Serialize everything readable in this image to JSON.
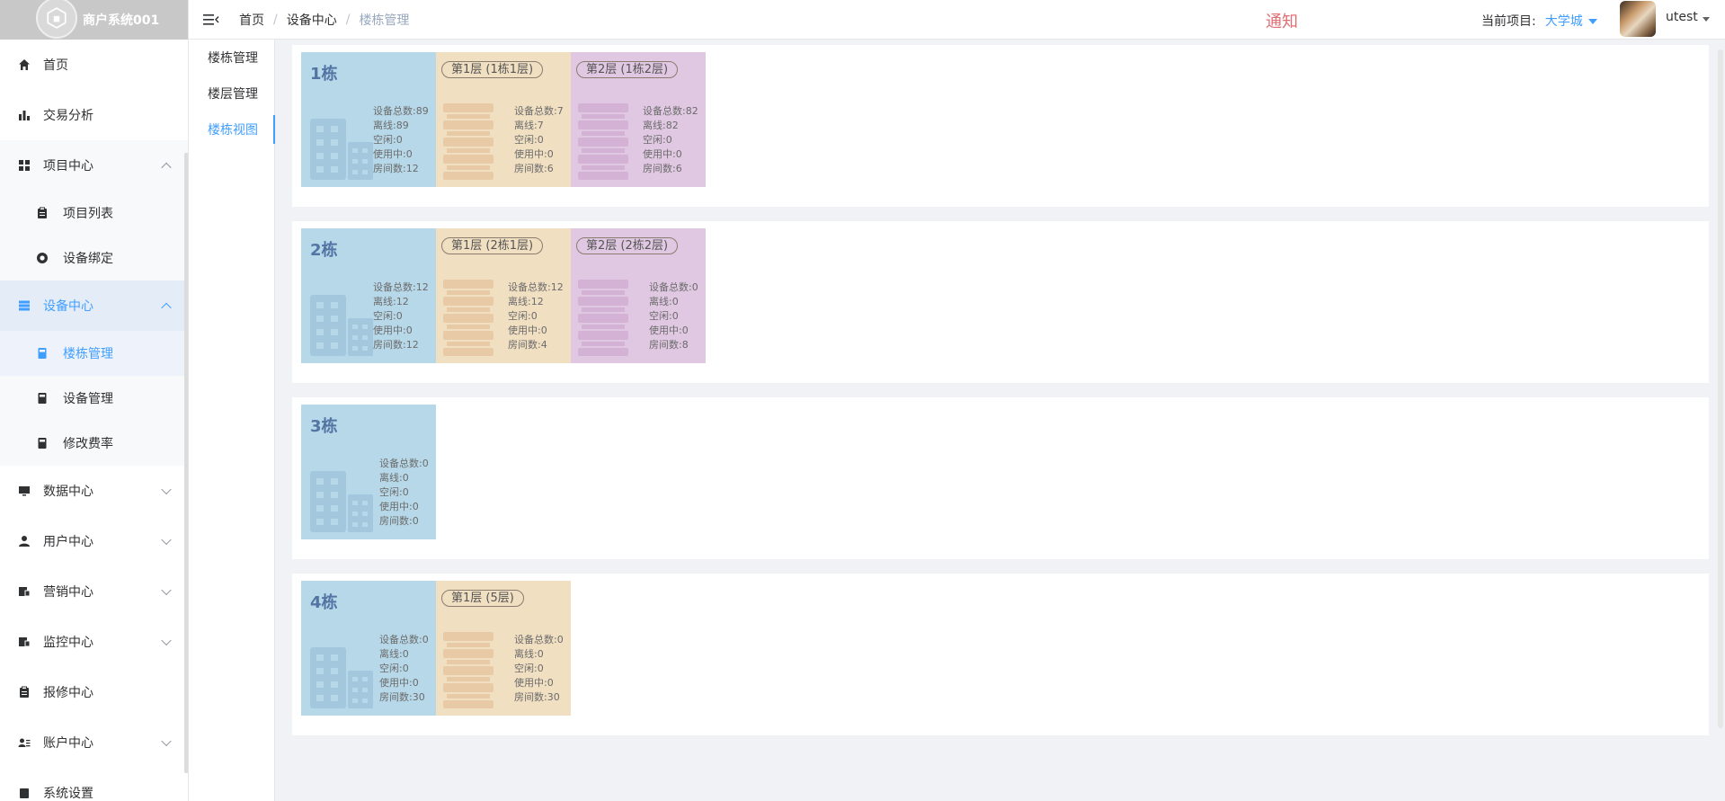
{
  "app": {
    "title": "商户系统001"
  },
  "sidebar": {
    "items": [
      {
        "label": "首页",
        "icon": "home-icon"
      },
      {
        "label": "交易分析",
        "icon": "bar-chart-icon"
      },
      {
        "label": "项目中心",
        "icon": "grid-icon",
        "sub": [
          {
            "label": "项目列表"
          },
          {
            "label": "设备绑定"
          }
        ]
      },
      {
        "label": "设备中心",
        "icon": "server-icon",
        "sub": [
          {
            "label": "楼栋管理"
          },
          {
            "label": "设备管理"
          },
          {
            "label": "修改费率"
          }
        ]
      },
      {
        "label": "数据中心",
        "icon": "monitor-icon"
      },
      {
        "label": "用户中心",
        "icon": "user-icon"
      },
      {
        "label": "营销中心",
        "icon": "marketing-icon"
      },
      {
        "label": "监控中心",
        "icon": "monitor-center-icon"
      },
      {
        "label": "报修中心",
        "icon": "clipboard-icon"
      },
      {
        "label": "账户中心",
        "icon": "account-icon"
      },
      {
        "label": "系统设置",
        "icon": "settings-icon"
      }
    ]
  },
  "subnav": {
    "items": [
      "楼栋管理",
      "楼层管理",
      "楼栋视图"
    ],
    "active": 2
  },
  "header": {
    "breadcrumb": [
      "首页",
      "设备中心",
      "楼栋管理"
    ],
    "notice": "通知",
    "project_label": "当前项目:",
    "project_value": "大学城",
    "username": "utest"
  },
  "buildings": [
    {
      "name": "1栋",
      "stats": [
        "设备总数:89",
        "离线:89",
        "空闲:0",
        "使用中:0",
        "房间数:12"
      ],
      "floors": [
        {
          "tag": "第1层 (1栋1层)",
          "stats": [
            "设备总数:7",
            "离线:7",
            "空闲:0",
            "使用中:0",
            "房间数:6"
          ]
        },
        {
          "tag": "第2层 (1栋2层)",
          "stats": [
            "设备总数:82",
            "离线:82",
            "空闲:0",
            "使用中:0",
            "房间数:6"
          ]
        }
      ]
    },
    {
      "name": "2栋",
      "stats": [
        "设备总数:12",
        "离线:12",
        "空闲:0",
        "使用中:0",
        "房间数:12"
      ],
      "floors": [
        {
          "tag": "第1层 (2栋1层)",
          "stats": [
            "设备总数:12",
            "离线:12",
            "空闲:0",
            "使用中:0",
            "房间数:4"
          ]
        },
        {
          "tag": "第2层 (2栋2层)",
          "stats": [
            "设备总数:0",
            "离线:0",
            "空闲:0",
            "使用中:0",
            "房间数:8"
          ]
        }
      ]
    },
    {
      "name": "3栋",
      "stats": [
        "设备总数:0",
        "离线:0",
        "空闲:0",
        "使用中:0",
        "房间数:0"
      ],
      "floors": []
    },
    {
      "name": "4栋",
      "stats": [
        "设备总数:0",
        "离线:0",
        "空闲:0",
        "使用中:0",
        "房间数:30"
      ],
      "floors": [
        {
          "tag": "第1层 (5层)",
          "stats": [
            "设备总数:0",
            "离线:0",
            "空闲:0",
            "使用中:0",
            "房间数:30"
          ]
        }
      ]
    }
  ],
  "colors": {
    "accent": "#409eff",
    "building_bg": "#b7d8e8",
    "floor1_bg": "#f1dfc2",
    "floor2_bg": "#e0c8e2",
    "notice": "#e06e73"
  }
}
